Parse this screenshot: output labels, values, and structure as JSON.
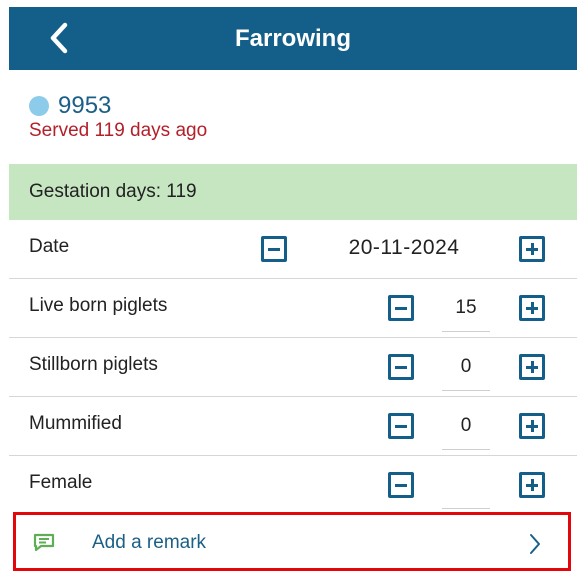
{
  "header": {
    "title": "Farrowing",
    "back_icon": "chevron-left-icon"
  },
  "animal": {
    "id": "9953",
    "dot_color": "#8ccbe9",
    "served": "Served 119 days ago"
  },
  "gestation": {
    "text": "Gestation days: 119"
  },
  "fields": {
    "date": {
      "label": "Date",
      "value": "20-11-2024"
    },
    "live_born": {
      "label": "Live born piglets",
      "value": "15"
    },
    "stillborn": {
      "label": "Stillborn piglets",
      "value": "0"
    },
    "mummified": {
      "label": "Mummified",
      "value": "0"
    },
    "female": {
      "label": "Female",
      "value": ""
    }
  },
  "remark": {
    "label": "Add a remark",
    "icon": "comment-icon",
    "chevron": "chevron-right-icon"
  },
  "colors": {
    "header": "#135f8a",
    "accent": "#1b5f87",
    "served": "#b3202a",
    "gestation_bg": "#c6e6c1",
    "highlight": "#e3060b",
    "remark_icon": "#5fae56"
  }
}
